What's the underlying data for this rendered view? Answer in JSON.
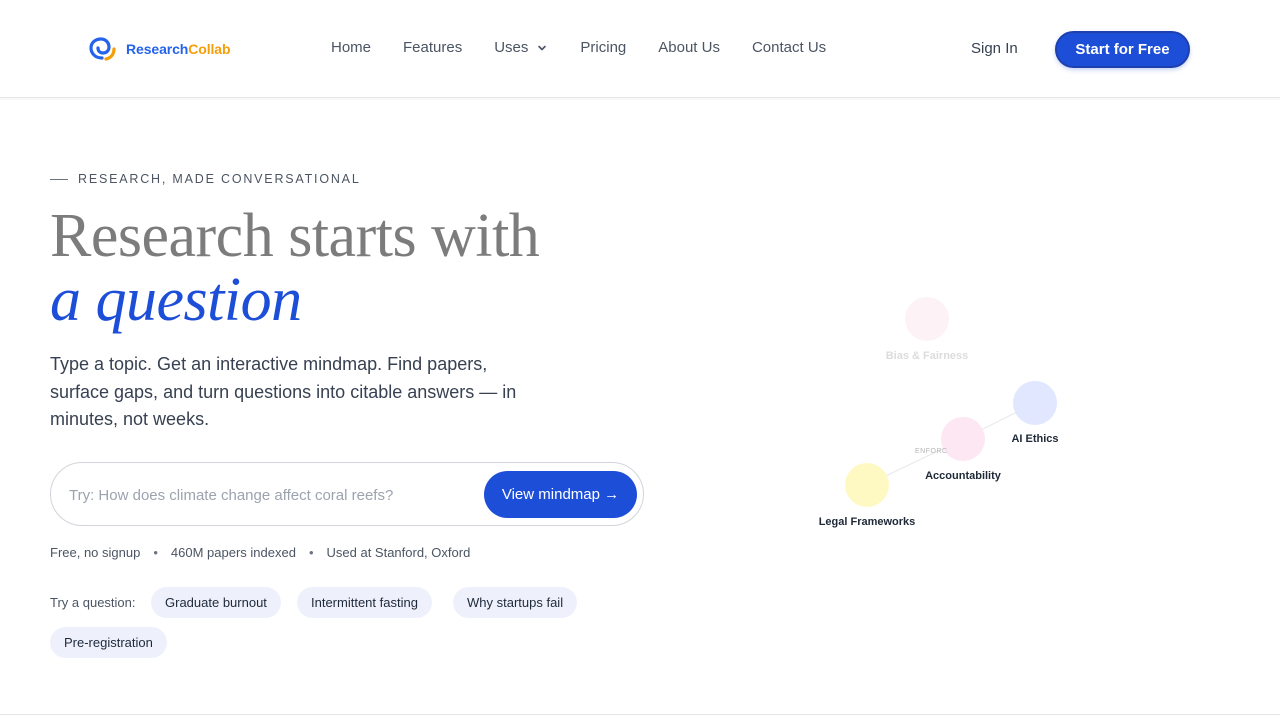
{
  "brand": {
    "name_part1": "Research",
    "name_part2": "Collab"
  },
  "nav": {
    "items": [
      {
        "label": "Home"
      },
      {
        "label": "Features"
      },
      {
        "label": "Uses",
        "has_dropdown": true
      },
      {
        "label": "Pricing"
      },
      {
        "label": "About Us"
      },
      {
        "label": "Contact Us"
      }
    ],
    "sign_in": "Sign In",
    "cta": "Start for Free"
  },
  "hero": {
    "eyebrow": "RESEARCH, MADE CONVERSATIONAL",
    "headline_line1": "Research starts with",
    "headline_line2": "a question",
    "subheadline": "Type a topic. Get an interactive mindmap. Find papers, surface gaps, and turn questions into citable answers — in minutes, not weeks.",
    "search": {
      "placeholder": "Try: How does climate change affect coral reefs?",
      "value": "",
      "button": "View mindmap →"
    },
    "meta": [
      "Free, no signup",
      "460M papers indexed",
      "Used at Stanford, Oxford"
    ],
    "try_label": "Try a question:",
    "suggestions": [
      "Graduate burnout",
      "Intermittent fasting",
      "Why startups fail",
      "Pre-registration"
    ]
  },
  "mindmap": {
    "nodes": [
      {
        "label": "Bias & Fairness",
        "color": "#fdf2f6",
        "faded": true
      },
      {
        "label": "AI Ethics",
        "color": "#e0e7ff",
        "faded": false
      },
      {
        "label": "Accountability",
        "color": "#fce7f3",
        "faded": false
      },
      {
        "label": "Legal Frameworks",
        "color": "#fef9c3",
        "faded": false
      }
    ],
    "edge_label": "ENFORC"
  },
  "colors": {
    "accent": "#1d4ed8",
    "brand_blue": "#2563eb",
    "brand_orange": "#f59e0b",
    "chip_bg": "#eef1fb"
  }
}
